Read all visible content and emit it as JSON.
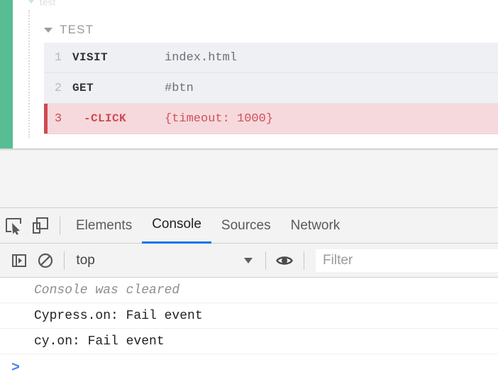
{
  "runner": {
    "ghost_suite_label": "test",
    "test_label": "TEST",
    "toggle_icon": "triangle-down-icon",
    "commands": [
      {
        "num": "1",
        "method": "VISIT",
        "args": "index.html",
        "state": "passed"
      },
      {
        "num": "2",
        "method": "GET",
        "args": "#btn",
        "state": "passed"
      },
      {
        "num": "3",
        "method": "-CLICK",
        "args": "{timeout: 1000}",
        "state": "failed"
      }
    ],
    "status_color": "#57bd95",
    "fail_color": "#cf4a50",
    "fail_bg": "#f6d9dd"
  },
  "devtools": {
    "inspect_icon": "inspect-element-icon",
    "device_icon": "device-toolbar-icon",
    "tabs": [
      {
        "label": "Elements",
        "active": false
      },
      {
        "label": "Console",
        "active": true
      },
      {
        "label": "Sources",
        "active": false
      },
      {
        "label": "Network",
        "active": false
      }
    ],
    "active_tab_color": "#1a73e8",
    "toolbar": {
      "sidebar_icon": "console-sidebar-icon",
      "clear_icon": "clear-console-icon",
      "context_value": "top",
      "context_caret_icon": "chevron-down-icon",
      "eye_icon": "live-expression-eye-icon",
      "filter_placeholder": "Filter",
      "filter_value": ""
    },
    "console": {
      "messages": [
        {
          "text": "Console was cleared",
          "kind": "cleared"
        },
        {
          "text": "Cypress.on: Fail event",
          "kind": "log"
        },
        {
          "text": "cy.on: Fail event",
          "kind": "log"
        }
      ],
      "prompt_glyph": ">",
      "prompt_value": ""
    }
  }
}
